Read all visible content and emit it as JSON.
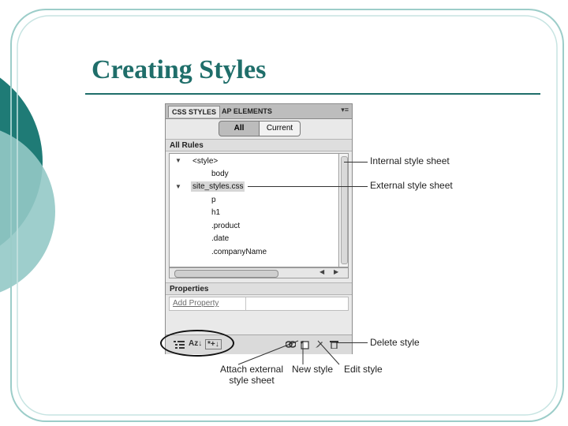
{
  "slide": {
    "title": "Creating Styles"
  },
  "panel": {
    "tabs": [
      {
        "label": "CSS STYLES",
        "active": true
      },
      {
        "label": "AP ELEMENTS",
        "active": false
      }
    ],
    "menu_icon": "panel-menu-icon",
    "toggle": {
      "all_label": "All",
      "current_label": "Current",
      "selected": "All"
    },
    "rules_header": "All Rules",
    "rules": [
      {
        "label": "<style>",
        "expandable": true,
        "indent": 0
      },
      {
        "label": "body",
        "expandable": false,
        "indent": 1
      },
      {
        "label": "site_styles.css",
        "expandable": true,
        "indent": 0,
        "selected": true
      },
      {
        "label": "p",
        "expandable": false,
        "indent": 1
      },
      {
        "label": "h1",
        "expandable": false,
        "indent": 1
      },
      {
        "label": ".product",
        "expandable": false,
        "indent": 1
      },
      {
        "label": ".date",
        "expandable": false,
        "indent": 1
      },
      {
        "label": ".companyName",
        "expandable": false,
        "indent": 1
      }
    ],
    "properties_header": "Properties",
    "add_property_label": "Add Property",
    "toolbar_left": [
      "show-category-view-icon",
      "show-alphabetical-view-icon",
      "show-set-properties-icon"
    ],
    "toolbar_right": [
      "attach-style-sheet-icon",
      "new-style-icon",
      "edit-style-icon",
      "delete-style-icon"
    ],
    "toolbar_left_text": {
      "az": "Az↓",
      "set": "*+↓"
    }
  },
  "callouts": {
    "internal": "Internal style sheet",
    "external": "External style sheet",
    "delete": "Delete style",
    "attach": [
      "Attach external",
      "style sheet"
    ],
    "new_style": "New style",
    "edit_style": "Edit style"
  },
  "colors": {
    "accent": "#1f6e6a",
    "teal_dark": "#1a7a75",
    "teal_light": "#8fc9c6"
  }
}
